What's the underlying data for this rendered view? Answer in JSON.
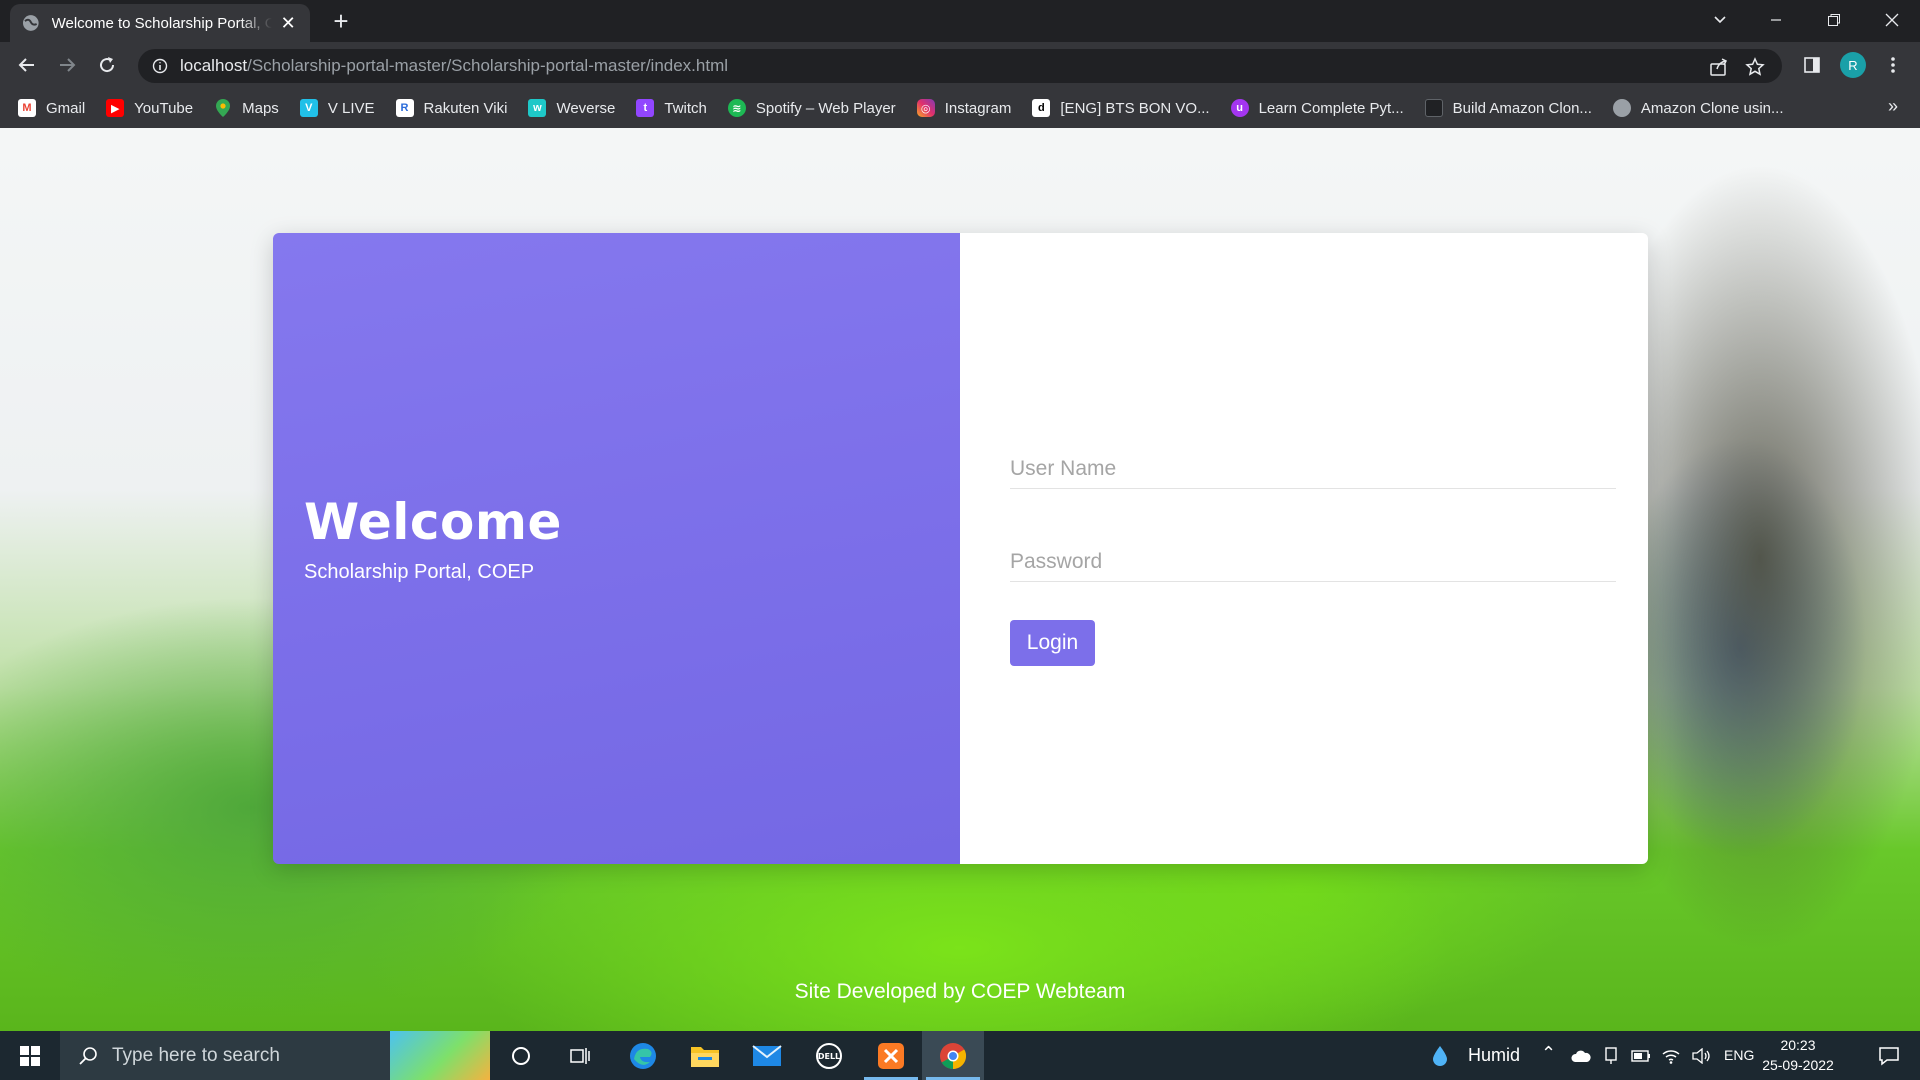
{
  "browser": {
    "tab_title": "Welcome to Scholarship Portal, COEP",
    "url_host": "localhost",
    "url_path": "/Scholarship-portal-master/Scholarship-portal-master/index.html",
    "profile_initial": "R",
    "bookmarks": [
      {
        "label": "Gmail",
        "icon": "gmail-icon",
        "color": "#ea4335"
      },
      {
        "label": "YouTube",
        "icon": "youtube-icon",
        "color": "#ff0000"
      },
      {
        "label": "Maps",
        "icon": "maps-icon",
        "color": "#34a853"
      },
      {
        "label": "V LIVE",
        "icon": "vlive-icon",
        "color": "#21c0e8"
      },
      {
        "label": "Rakuten Viki",
        "icon": "viki-icon",
        "color": "#2a6bd9"
      },
      {
        "label": "Weverse",
        "icon": "weverse-icon",
        "color": "#1ec8c8"
      },
      {
        "label": "Twitch",
        "icon": "twitch-icon",
        "color": "#9146ff"
      },
      {
        "label": "Spotify – Web Player",
        "icon": "spotify-icon",
        "color": "#1db954"
      },
      {
        "label": "Instagram",
        "icon": "instagram-icon",
        "color": "#e1306c"
      },
      {
        "label": "[ENG] BTS BON VO...",
        "icon": "dailymotion-icon",
        "color": "#ffffff"
      },
      {
        "label": "Learn Complete Pyt...",
        "icon": "udemy-icon",
        "color": "#a435f0"
      },
      {
        "label": "Build Amazon Clon...",
        "icon": "page-icon",
        "color": "#202124"
      },
      {
        "label": "Amazon Clone usin...",
        "icon": "globe-icon",
        "color": "#9aa0a6"
      }
    ]
  },
  "page": {
    "welcome_title": "Welcome",
    "welcome_subtitle": "Scholarship Portal, COEP",
    "username_placeholder": "User Name",
    "password_placeholder": "Password",
    "login_label": "Login",
    "footer_text": "Site Developed by COEP Webteam",
    "accent_color": "#7c6fea"
  },
  "taskbar": {
    "search_placeholder": "Type here to search",
    "weather_label": "Humid",
    "language": "ENG",
    "time": "20:23",
    "date": "25-09-2022"
  }
}
